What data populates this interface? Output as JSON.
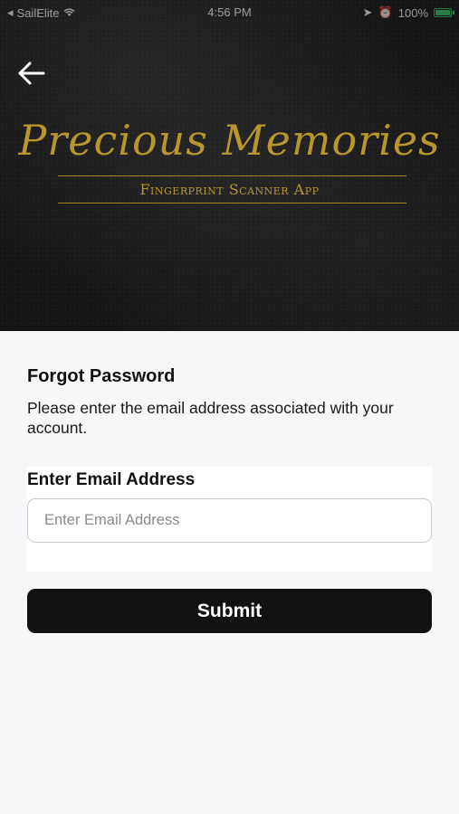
{
  "status_bar": {
    "carrier": "SailElite",
    "time": "4:56 PM",
    "battery": "100%"
  },
  "header": {
    "back_icon": "arrow-left-icon",
    "logo_title": "Precious Memories",
    "logo_subtitle": "Fingerprint Scanner App"
  },
  "form": {
    "title": "Forgot Password",
    "description": "Please enter the email address associated with your account.",
    "email_label": "Enter Email Address",
    "email_placeholder": "Enter Email Address",
    "email_value": "",
    "submit_label": "Submit"
  },
  "colors": {
    "header_background": "#141414",
    "logo_gold": "#b8962e",
    "button_background": "#111111",
    "page_background": "#f6f7f9"
  }
}
